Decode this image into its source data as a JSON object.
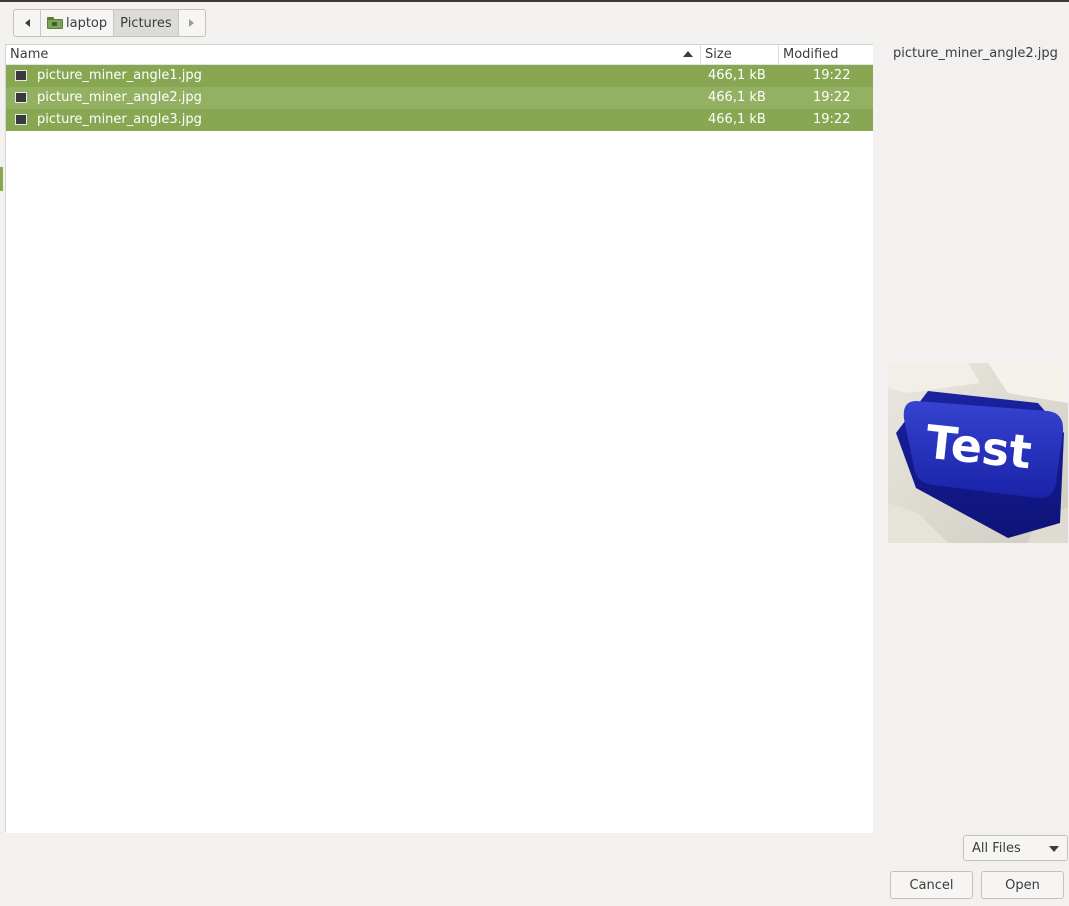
{
  "pathbar": {
    "segments": [
      {
        "label": "laptop",
        "icon": "folder-icon"
      },
      {
        "label": "Pictures",
        "current": true
      }
    ]
  },
  "filelist": {
    "columns": {
      "name": "Name",
      "size": "Size",
      "modified": "Modified"
    },
    "rows": [
      {
        "name": "picture_miner_angle1.jpg",
        "size": "466,1 kB",
        "modified": "19:22",
        "selected": true
      },
      {
        "name": "picture_miner_angle2.jpg",
        "size": "466,1 kB",
        "modified": "19:22",
        "selected": true
      },
      {
        "name": "picture_miner_angle3.jpg",
        "size": "466,1 kB",
        "modified": "19:22",
        "selected": true
      }
    ]
  },
  "preview": {
    "filename": "picture_miner_angle2.jpg",
    "image_text": "Test"
  },
  "footer": {
    "filter": "All Files",
    "cancel": "Cancel",
    "open": "Open"
  },
  "colors": {
    "selection": "#87a752",
    "selection_hover": "#93b162",
    "key_blue": "#1f2db8"
  }
}
